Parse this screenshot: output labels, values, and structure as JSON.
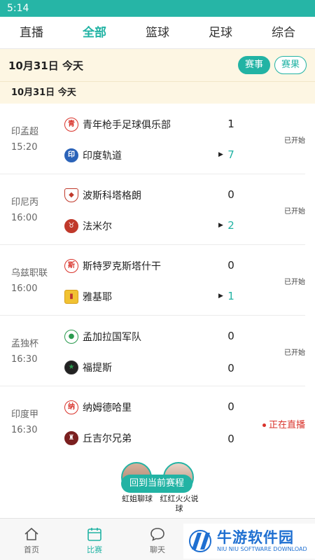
{
  "status_bar": {
    "time": "5:14"
  },
  "tabs": [
    "直播",
    "全部",
    "篮球",
    "足球",
    "综合"
  ],
  "active_tab": 1,
  "date_header": {
    "date": "10月31日  今天",
    "btn_matches": "赛事",
    "btn_results": "赛果"
  },
  "sub_header": {
    "date": "10月31日   今天"
  },
  "matches": [
    {
      "league": "印孟超",
      "time": "15:20",
      "home": "青年枪手足球俱乐部",
      "home_badge": "青",
      "away": "印度轨道",
      "away_badge": "印",
      "home_score": "1",
      "away_score": "7",
      "status": "已开始",
      "live": false
    },
    {
      "league": "印尼丙",
      "time": "16:00",
      "home": "波斯科塔格朗",
      "home_badge": "",
      "away": "法米尔",
      "away_badge": "",
      "home_score": "0",
      "away_score": "2",
      "status": "已开始",
      "live": false
    },
    {
      "league": "乌兹职联",
      "time": "16:00",
      "home": "斯特罗克斯塔什干",
      "home_badge": "斯",
      "away": "雅基耶",
      "away_badge": "",
      "home_score": "0",
      "away_score": "1",
      "status": "已开始",
      "live": false
    },
    {
      "league": "孟独杯",
      "time": "16:30",
      "home": "孟加拉国军队",
      "home_badge": "",
      "away": "福提斯",
      "away_badge": "",
      "home_score": "0",
      "away_score": "0",
      "status": "已开始",
      "live": false
    },
    {
      "league": "印度甲",
      "time": "16:30",
      "home": "纳姆德哈里",
      "home_badge": "纳",
      "away": "丘吉尔兄弟",
      "away_badge": "",
      "home_score": "0",
      "away_score": "0",
      "status": "正在直播",
      "live": true
    }
  ],
  "floating": {
    "button": "回到当前赛程",
    "streamer1": "虹姐聊球",
    "streamer2": "红红火火说球"
  },
  "bottom_nav": [
    "首页",
    "比赛",
    "聊天"
  ],
  "watermark": {
    "main": "牛游软件园",
    "sub": "NIU NIU SOFTWARE DOWNLOAD"
  },
  "colors": {
    "accent": "#22b3a4",
    "live": "#d9332b",
    "header_bg": "#fdf6e3"
  }
}
